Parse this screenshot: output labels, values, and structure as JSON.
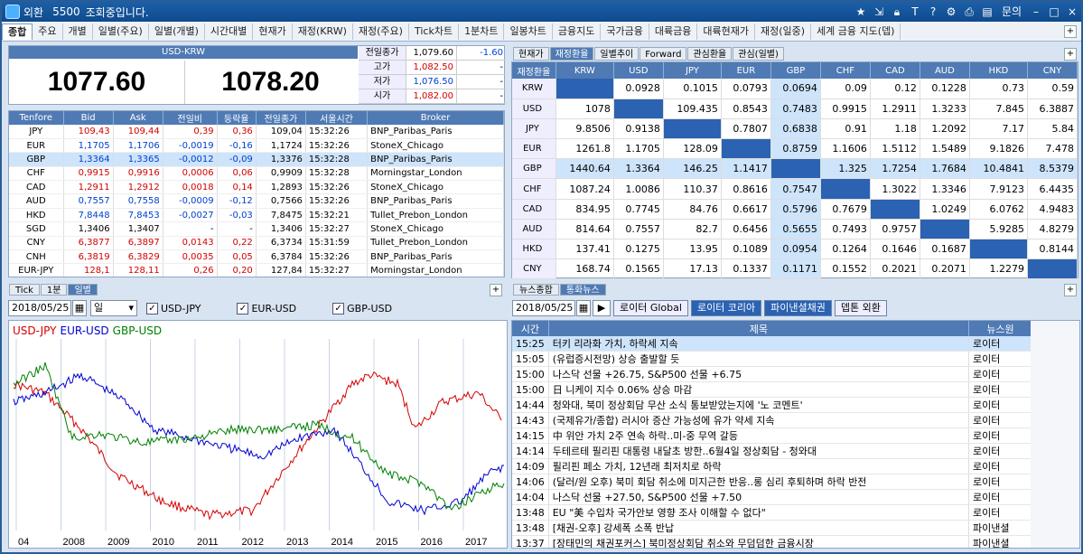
{
  "title": {
    "app": "외환",
    "code": "5500",
    "status": "조회중입니다.",
    "menu": "문의"
  },
  "tabs": [
    "종합",
    "주요",
    "개별",
    "일별(주요)",
    "일별(개별)",
    "시간대별",
    "현재가",
    "재정(KRW)",
    "재정(주요)",
    "Tick차트",
    "1분차트",
    "일봉차트",
    "금융지도",
    "국가금융",
    "대륙금융",
    "대륙현재가",
    "재정(일중)",
    "세계 금융 지도(뎁)"
  ],
  "quote": {
    "pair": "USD-KRW",
    "bid": "1077.60",
    "ask": "1078.20",
    "side": [
      {
        "label": "전일종가",
        "value": "1,079.60",
        "chg": "-1.60"
      },
      {
        "label": "고가",
        "value": "1,082.50",
        "chg": "-"
      },
      {
        "label": "저가",
        "value": "1,076.50",
        "chg": "-"
      },
      {
        "label": "시가",
        "value": "1,082.00",
        "chg": "-"
      }
    ]
  },
  "tenors": {
    "headers": [
      "Tenfore",
      "Bid",
      "Ask",
      "전일비",
      "등락율",
      "전일종가",
      "서울시간",
      "Broker"
    ],
    "rows": [
      [
        "JPY",
        "109,43",
        "109,44",
        "0,39",
        "0,36",
        "109,04",
        "15:32:26",
        "BNP_Paribas_Paris"
      ],
      [
        "EUR",
        "1,1705",
        "1,1706",
        "-0,0019",
        "-0,16",
        "1,1724",
        "15:32:26",
        "StoneX_Chicago"
      ],
      [
        "GBP",
        "1,3364",
        "1,3365",
        "-0,0012",
        "-0,09",
        "1,3376",
        "15:32:28",
        "BNP_Paribas_Paris"
      ],
      [
        "CHF",
        "0,9915",
        "0,9916",
        "0,0006",
        "0,06",
        "0,9909",
        "15:32:28",
        "Morningstar_London"
      ],
      [
        "CAD",
        "1,2911",
        "1,2912",
        "0,0018",
        "0,14",
        "1,2893",
        "15:32:26",
        "StoneX_Chicago"
      ],
      [
        "AUD",
        "0,7557",
        "0,7558",
        "-0,0009",
        "-0,12",
        "0,7566",
        "15:32:26",
        "BNP_Paribas_Paris"
      ],
      [
        "HKD",
        "7,8448",
        "7,8453",
        "-0,0027",
        "-0,03",
        "7,8475",
        "15:32:21",
        "Tullet_Prebon_London"
      ],
      [
        "SGD",
        "1,3406",
        "1,3407",
        "-",
        "-",
        "1,3406",
        "15:32:27",
        "StoneX_Chicago"
      ],
      [
        "CNY",
        "6,3877",
        "6,3897",
        "0,0143",
        "0,22",
        "6,3734",
        "15:31:59",
        "Tullet_Prebon_London"
      ],
      [
        "CNH",
        "6,3819",
        "6,3829",
        "0,0035",
        "0,05",
        "6,3784",
        "15:32:26",
        "BNP_Paribas_Paris"
      ],
      [
        "EUR-JPY",
        "128,1",
        "128,11",
        "0,26",
        "0,20",
        "127,84",
        "15:32:27",
        "Morningstar_London"
      ]
    ]
  },
  "rtabs": [
    "현재가",
    "재정환율",
    "일별추이",
    "Forward",
    "관심환율",
    "관심(일별)"
  ],
  "matrix": {
    "headers": [
      "재정환율",
      "KRW",
      "USD",
      "JPY",
      "EUR",
      "GBP",
      "CHF",
      "CAD",
      "AUD",
      "HKD",
      "CNY"
    ],
    "rows": [
      [
        "KRW",
        "",
        "0.0928",
        "0.1015",
        "0.0793",
        "0.0694",
        "0.09",
        "0.12",
        "0.1228",
        "0.73",
        "0.59"
      ],
      [
        "USD",
        "1078",
        "",
        "109.435",
        "0.8543",
        "0.7483",
        "0.9915",
        "1.2911",
        "1.3233",
        "7.845",
        "6.3887"
      ],
      [
        "JPY",
        "9.8506",
        "0.9138",
        "",
        "0.7807",
        "0.6838",
        "0.91",
        "1.18",
        "1.2092",
        "7.17",
        "5.84"
      ],
      [
        "EUR",
        "1261.8",
        "1.1705",
        "128.09",
        "",
        "0.8759",
        "1.1606",
        "1.5112",
        "1.5489",
        "9.1826",
        "7.478"
      ],
      [
        "GBP",
        "1440.64",
        "1.3364",
        "146.25",
        "1.1417",
        "",
        "1.325",
        "1.7254",
        "1.7684",
        "10.4841",
        "8.5379"
      ],
      [
        "CHF",
        "1087.24",
        "1.0086",
        "110.37",
        "0.8616",
        "0.7547",
        "",
        "1.3022",
        "1.3346",
        "7.9123",
        "6.4435"
      ],
      [
        "CAD",
        "834.95",
        "0.7745",
        "84.76",
        "0.6617",
        "0.5796",
        "0.7679",
        "",
        "1.0249",
        "6.0762",
        "4.9483"
      ],
      [
        "AUD",
        "814.64",
        "0.7557",
        "82.7",
        "0.6456",
        "0.5655",
        "0.7493",
        "0.9757",
        "",
        "5.9285",
        "4.8279"
      ],
      [
        "HKD",
        "137.41",
        "0.1275",
        "13.95",
        "0.1089",
        "0.0954",
        "0.1264",
        "0.1646",
        "0.1687",
        "",
        "0.8144"
      ],
      [
        "CNY",
        "168.74",
        "0.1565",
        "17.13",
        "0.1337",
        "0.1171",
        "0.1552",
        "0.2021",
        "0.2071",
        "1.2279",
        ""
      ]
    ]
  },
  "ctabs": [
    "Tick",
    "1분",
    "일별"
  ],
  "chartbar": {
    "date": "2018/05/25",
    "period": "일",
    "checks": [
      "USD-JPY",
      "EUR-USD",
      "GBP-USD"
    ]
  },
  "chart_data": {
    "type": "line",
    "series": [
      {
        "name": "USD-JPY",
        "color": "#d40000"
      },
      {
        "name": "EUR-USD",
        "color": "#0000d0"
      },
      {
        "name": "GBP-USD",
        "color": "#008000"
      }
    ],
    "xticks": [
      "04",
      "2008",
      "2009",
      "2010",
      "2011",
      "2012",
      "2013",
      "2014",
      "2015",
      "2016",
      "2017"
    ]
  },
  "ntabs": [
    "뉴스종합",
    "통화뉴스"
  ],
  "newsbar": {
    "date": "2018/05/25",
    "buttons": [
      "로이터 Global",
      "로이터 코리아",
      "파이낸셜채권",
      "뎁톤 외환"
    ]
  },
  "news": {
    "headers": [
      "시간",
      "제목",
      "뉴스원"
    ],
    "rows": [
      [
        "15:25",
        "터키 리라화 가치, 하락세 지속",
        "로이터"
      ],
      [
        "15:05",
        "(유럽증시전망) 상승 출발할 듯",
        "로이터"
      ],
      [
        "15:00",
        "나스닥 선물 +26.75, S&P500 선물 +6.75",
        "로이터"
      ],
      [
        "15:00",
        "日 니케이 지수 0.06% 상승 마감",
        "로이터"
      ],
      [
        "14:44",
        "청와대, 북미 정상회담 무산 소식 통보받았는지에 '노 코멘트'",
        "로이터"
      ],
      [
        "14:43",
        "(국제유가/종합) 러시아 증산 가능성에 유가 약세 지속",
        "로이터"
      ],
      [
        "14:15",
        "中 위안 가치 2주 연속 하락..미-중 무역 갈등",
        "로이터"
      ],
      [
        "14:14",
        "두테르테 필리핀 대통령 내달초 방한..6월4일 정상회담 - 청와대",
        "로이터"
      ],
      [
        "14:09",
        "필리핀 페소 가치, 12년래 최저치로 하락",
        "로이터"
      ],
      [
        "14:06",
        "(달러/원 오후) 북미 회담 취소에 미지근한 반응..롱 심리 후퇴하며 하락 반전",
        "로이터"
      ],
      [
        "14:04",
        "나스닥 선물 +27.50, S&P500 선물 +7.50",
        "로이터"
      ],
      [
        "13:48",
        "EU \"美 수입차 국가안보 영향 조사 이해할 수 없다\"",
        "로이터"
      ],
      [
        "13:48",
        "[채권-오후] 강세폭 소폭 반납",
        "파이낸셜"
      ],
      [
        "13:37",
        "[장태민의 채권포커스] 북미정상회담 취소와 무덤덤한 금융시장",
        "파이낸셜"
      ]
    ]
  }
}
